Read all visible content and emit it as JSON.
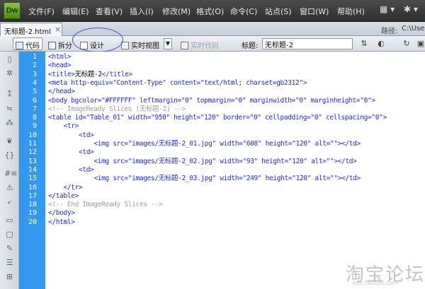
{
  "app": {
    "logo": "Dw"
  },
  "menu": [
    "文件(F)",
    "编辑(E)",
    "查看(V)",
    "插入(I)",
    "修改(M)",
    "格式(O)",
    "命令(C)",
    "站点(S)",
    "窗口(W)",
    "帮助(H)"
  ],
  "menu_right": {
    "layout_icon": "layout-icon",
    "settings_icon": "gear-icon"
  },
  "document_tab": {
    "name": "无标题-2.html",
    "close": "×"
  },
  "path": {
    "label": "路径:",
    "value": "C:\\Use"
  },
  "toolbar": {
    "code": "代码",
    "split": "拆分",
    "design": "设计",
    "live_view": "实时视图",
    "live_code": "实时代码",
    "title_label": "标题:",
    "title_value": "无标题-2"
  },
  "gutter": {
    "color": "#3399ee"
  },
  "code_lines": [
    [
      {
        "t": "tag",
        "v": "<html>"
      }
    ],
    [
      {
        "t": "tag",
        "v": "<head>"
      }
    ],
    [
      {
        "t": "tag",
        "v": "<title>"
      },
      {
        "t": "text",
        "v": "无标题-2"
      },
      {
        "t": "tag",
        "v": "</title>"
      }
    ],
    [
      {
        "t": "tag",
        "v": "<meta http-equiv=\"Content-Type\" content=\"text/html; charset=gb2312\">"
      }
    ],
    [
      {
        "t": "tag",
        "v": "</head>"
      }
    ],
    [
      {
        "t": "tag",
        "v": "<body bgcolor=\"#FFFFFF\" leftmargin=\"0\" topmargin=\"0\" marginwidth=\"0\" marginheight=\"0\">"
      }
    ],
    [
      {
        "t": "comment",
        "v": "<!-- ImageReady Slices (无标题-2) -->"
      }
    ],
    [
      {
        "t": "tag",
        "v": "<table id=\"Table_01\" width=\"950\" height=\"120\" border=\"0\" cellpadding=\"0\" cellspacing=\"0\">"
      }
    ],
    [
      {
        "t": "text",
        "v": "    "
      },
      {
        "t": "tag",
        "v": "<tr>"
      }
    ],
    [
      {
        "t": "text",
        "v": "        "
      },
      {
        "t": "tag",
        "v": "<td>"
      }
    ],
    [
      {
        "t": "text",
        "v": "            "
      },
      {
        "t": "tag",
        "v": "<img src=\"images/无标题-2_01.jpg\" width=\"608\" height=\"120\" alt=\"\">"
      },
      {
        "t": "tag",
        "v": "</td>"
      }
    ],
    [
      {
        "t": "text",
        "v": "        "
      },
      {
        "t": "tag",
        "v": "<td>"
      }
    ],
    [
      {
        "t": "text",
        "v": "            "
      },
      {
        "t": "tag",
        "v": "<img src=\"images/无标题-2_02.jpg\" width=\"93\" height=\"120\" alt=\"\">"
      },
      {
        "t": "tag",
        "v": "</td>"
      }
    ],
    [
      {
        "t": "text",
        "v": "        "
      },
      {
        "t": "tag",
        "v": "<td>"
      }
    ],
    [
      {
        "t": "text",
        "v": "            "
      },
      {
        "t": "tag",
        "v": "<img src=\"images/无标题-2_03.jpg\" width=\"249\" height=\"120\" alt=\"\">"
      },
      {
        "t": "tag",
        "v": "</td>"
      }
    ],
    [
      {
        "t": "text",
        "v": "    "
      },
      {
        "t": "tag",
        "v": "</tr>"
      }
    ],
    [
      {
        "t": "tag",
        "v": "</table>"
      }
    ],
    [
      {
        "t": "comment",
        "v": "<!-- End ImageReady Slices -->"
      }
    ],
    [
      {
        "t": "tag",
        "v": "</body>"
      }
    ],
    [
      {
        "t": "tag",
        "v": "</html>"
      }
    ]
  ],
  "watermark": {
    "text": "淘宝论坛",
    "url": "bbs.taobao.com"
  }
}
